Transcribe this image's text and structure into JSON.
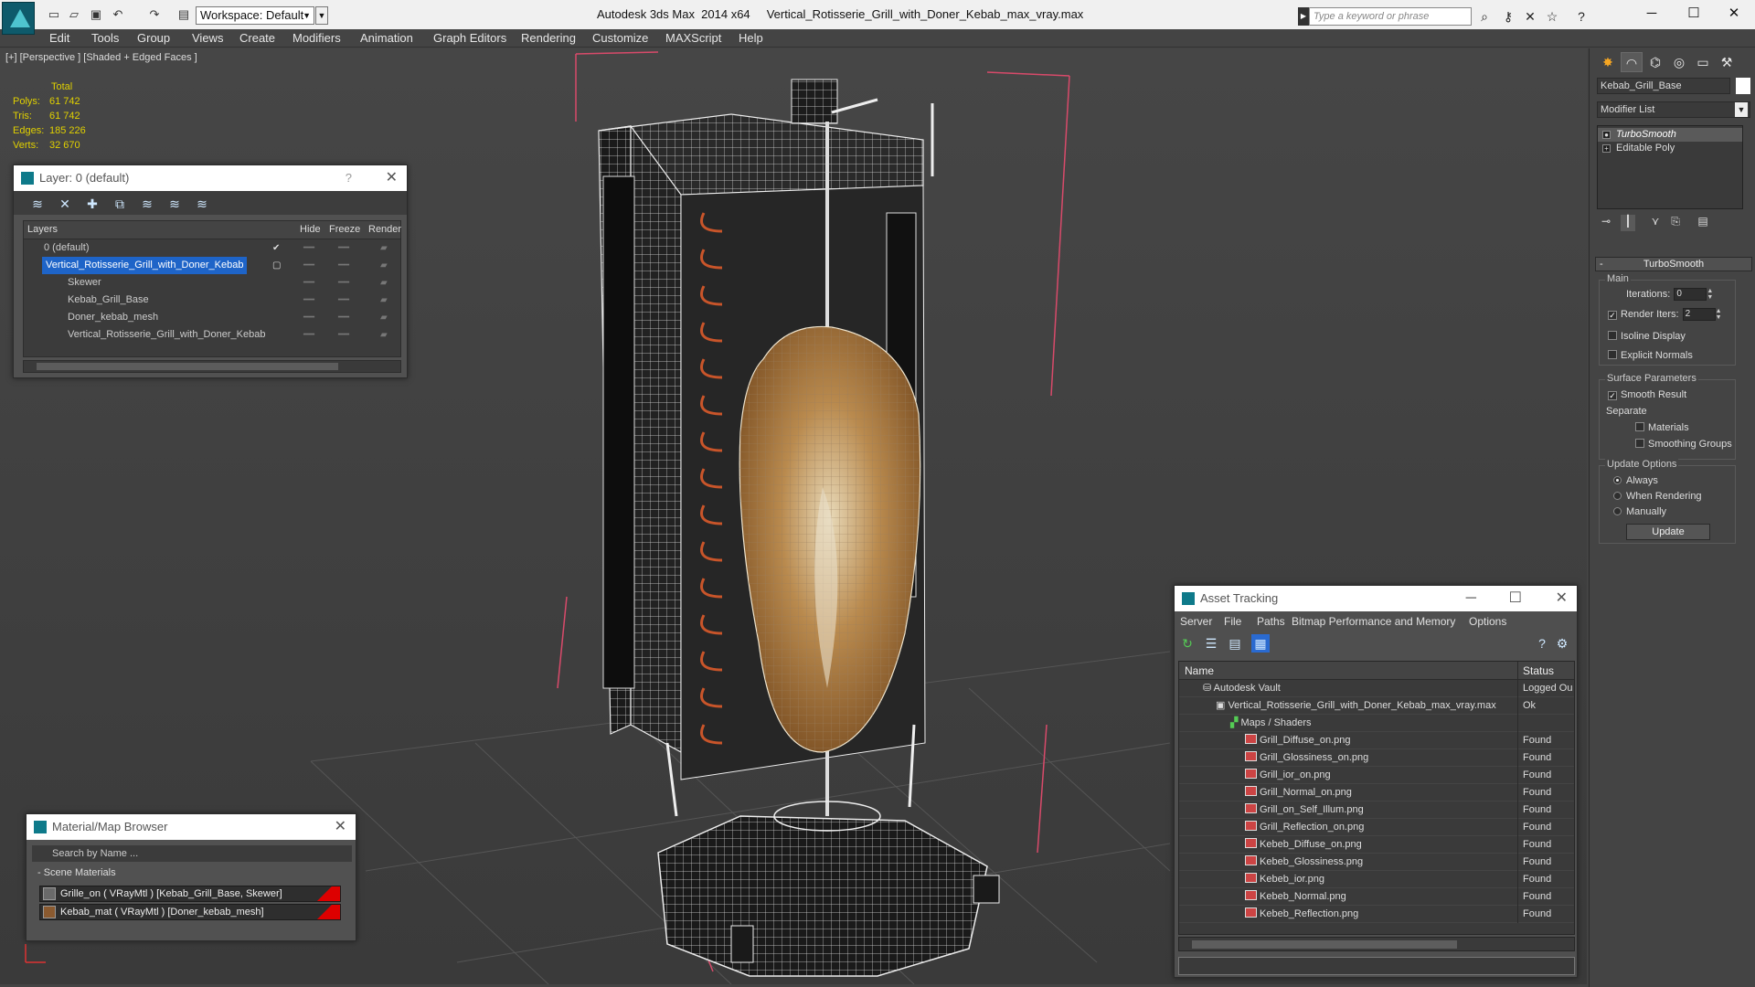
{
  "app": {
    "title": "Autodesk 3ds Max  2014 x64     Vertical_Rotisserie_Grill_with_Doner_Kebab_max_vray.max",
    "workspace": "Workspace: Default",
    "search_placeholder": "Type a keyword or phrase"
  },
  "menu": [
    "Edit",
    "Tools",
    "Group",
    "Views",
    "Create",
    "Modifiers",
    "Animation",
    "Graph Editors",
    "Rendering",
    "Customize",
    "MAXScript",
    "Help"
  ],
  "viewport": {
    "label": "[+] [Perspective ] [Shaded + Edged Faces ]",
    "stats": {
      "header": "Total",
      "polys_label": "Polys:",
      "polys": "61 742",
      "tris_label": "Tris:",
      "tris": "61 742",
      "edges_label": "Edges:",
      "edges": "185 226",
      "verts_label": "Verts:",
      "verts": "32 670"
    }
  },
  "layer_window": {
    "title": "Layer: 0 (default)",
    "help": "?",
    "columns": {
      "layers": "Layers",
      "hide": "Hide",
      "freeze": "Freeze",
      "render": "Render"
    },
    "rows": [
      "0 (default)",
      "Vertical_Rotisserie_Grill_with_Doner_Kebab",
      "Skewer",
      "Kebab_Grill_Base",
      "Doner_kebab_mesh",
      "Vertical_Rotisserie_Grill_with_Doner_Kebab"
    ]
  },
  "material_browser": {
    "title": "Material/Map Browser",
    "search_placeholder": "Search by Name ...",
    "section": "- Scene Materials",
    "materials": [
      "Grille_on  ( VRayMtl ) [Kebab_Grill_Base, Skewer]",
      "Kebab_mat  ( VRayMtl ) [Doner_kebab_mesh]"
    ]
  },
  "asset_tracking": {
    "title": "Asset Tracking",
    "menu": [
      "Server",
      "File",
      "Paths",
      "Bitmap Performance and Memory",
      "Options"
    ],
    "columns": {
      "name": "Name",
      "status": "Status"
    },
    "rows": [
      {
        "name": "Autodesk Vault",
        "status": "Logged Ou"
      },
      {
        "name": "Vertical_Rotisserie_Grill_with_Doner_Kebab_max_vray.max",
        "status": "Ok"
      },
      {
        "name": "Maps / Shaders",
        "status": ""
      },
      {
        "name": "Grill_Diffuse_on.png",
        "status": "Found"
      },
      {
        "name": "Grill_Glossiness_on.png",
        "status": "Found"
      },
      {
        "name": "Grill_ior_on.png",
        "status": "Found"
      },
      {
        "name": "Grill_Normal_on.png",
        "status": "Found"
      },
      {
        "name": "Grill_on_Self_Illum.png",
        "status": "Found"
      },
      {
        "name": "Grill_Reflection_on.png",
        "status": "Found"
      },
      {
        "name": "Kebeb_Diffuse_on.png",
        "status": "Found"
      },
      {
        "name": "Kebeb_Glossiness.png",
        "status": "Found"
      },
      {
        "name": "Kebeb_ior.png",
        "status": "Found"
      },
      {
        "name": "Kebeb_Normal.png",
        "status": "Found"
      },
      {
        "name": "Kebeb_Reflection.png",
        "status": "Found"
      }
    ]
  },
  "command_panel": {
    "object_name": "Kebab_Grill_Base",
    "modifier_list": "Modifier List",
    "stack": [
      "TurboSmooth",
      "Editable Poly"
    ],
    "rollout_title": "TurboSmooth",
    "main": {
      "group": "Main",
      "iterations_label": "Iterations:",
      "iterations": "0",
      "render_iters_label": "Render Iters:",
      "render_iters": "2",
      "isoline": "Isoline Display",
      "explicit_normals": "Explicit Normals"
    },
    "surface": {
      "group": "Surface Parameters",
      "smooth_result": "Smooth Result",
      "separate": "Separate",
      "materials": "Materials",
      "smoothing_groups": "Smoothing Groups"
    },
    "update": {
      "group": "Update Options",
      "always": "Always",
      "when_rendering": "When Rendering",
      "manually": "Manually",
      "button": "Update"
    }
  }
}
